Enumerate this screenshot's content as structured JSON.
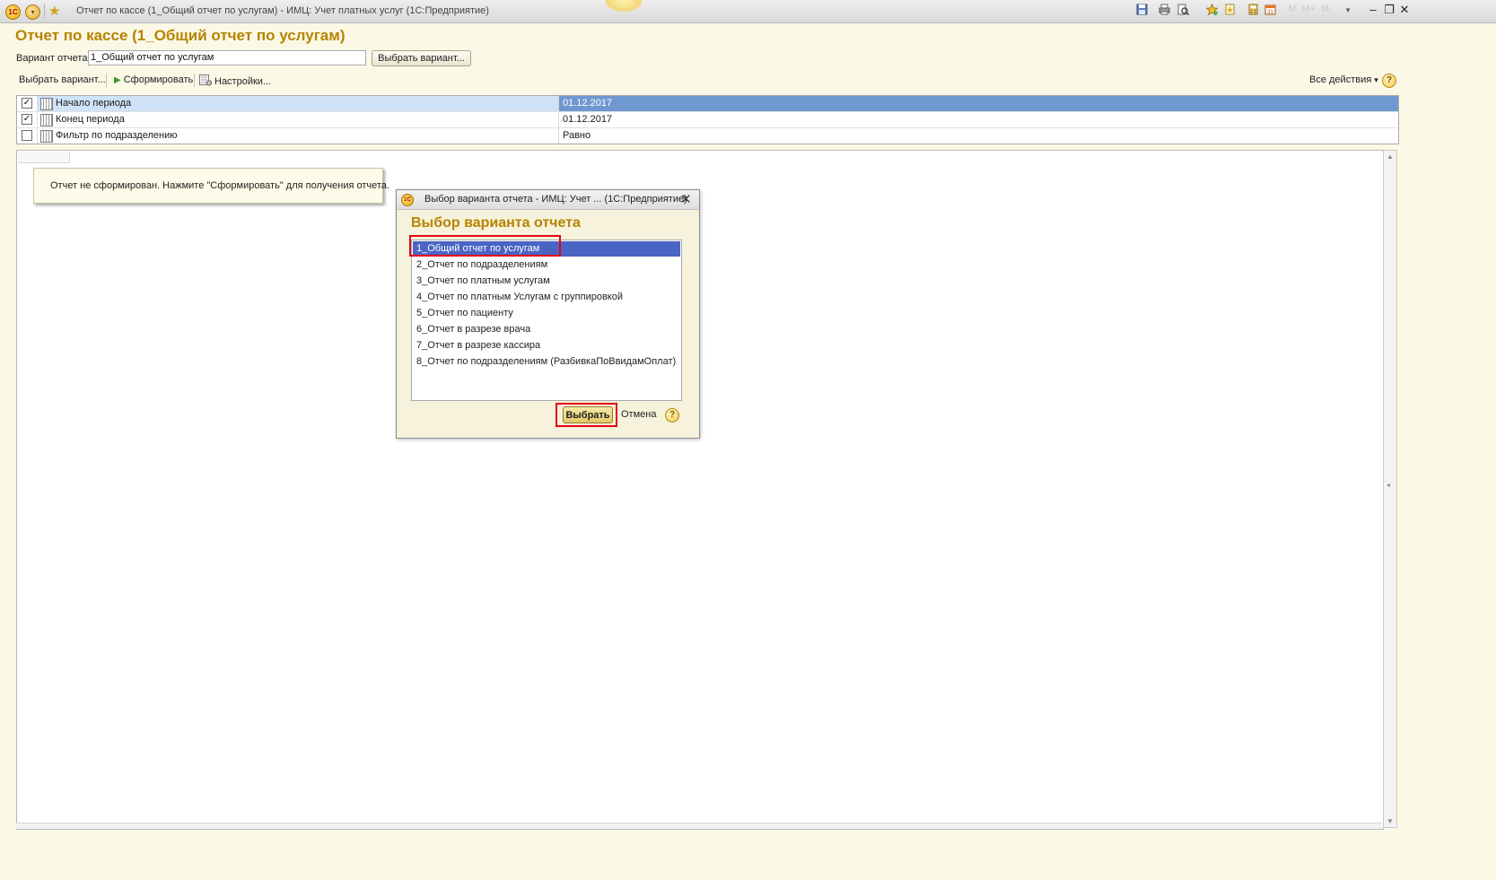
{
  "window": {
    "title": "Отчет по кассе (1_Общий отчет по услугам) - ИМЦ: Учет платных услуг  (1С:Предприятие)",
    "logo_text": "1С",
    "menu_glyph": "▾",
    "favorites_glyph": "★",
    "toolbar_icons": [
      "save-icon",
      "print-icon",
      "preview-icon",
      "favorites-add-icon",
      "history-icon",
      "calculator-icon",
      "calendar-icon",
      "memory-icon",
      "dropdown-icon"
    ],
    "controls": {
      "minimize": "‒",
      "restore": "❐",
      "close": "✕"
    }
  },
  "header": {
    "page_title": "Отчет по кассе (1_Общий отчет по услугам)",
    "variant_label": "Вариант отчета:",
    "variant_value": "1_Общий отчет по услугам",
    "choose_variant_button": "Выбрать вариант..."
  },
  "command_bar": {
    "choose_variant": "Выбрать вариант...",
    "generate": "Сформировать",
    "settings": "Настройки...",
    "all_actions": "Все действия",
    "all_actions_arrow": "▾",
    "help": "?"
  },
  "settings": {
    "rows": [
      {
        "checked": true,
        "check_glyph": "✓",
        "label": "Начало периода",
        "value": "01.12.2017",
        "extra": ""
      },
      {
        "checked": true,
        "check_glyph": "✓",
        "label": "Конец периода",
        "value": "01.12.2017",
        "extra": ""
      },
      {
        "checked": false,
        "check_glyph": "",
        "label": "Фильтр по подразделению",
        "value": "Равно",
        "extra": ""
      }
    ]
  },
  "report": {
    "notice": "Отчет не сформирован. Нажмите \"Сформировать\" для получения отчета."
  },
  "dialog": {
    "title": "Выбор варианта отчета - ИМЦ: Учет ...  (1С:Предприятие)",
    "heading": "Выбор варианта отчета",
    "items": [
      "1_Общий отчет по услугам",
      "2_Отчет по подразделениям",
      "3_Отчет по платным услугам",
      "4_Отчет по платным Услугам с группировкой",
      "5_Отчет по пациенту",
      "6_Отчет в разрезе врача",
      "7_Отчет в разрезе кассира",
      "8_Отчет по подразделениям (РазбивкаПоВвидамОплат)"
    ],
    "selected_index": 0,
    "choose_button": "Выбрать",
    "cancel_button": "Отмена",
    "help": "?",
    "close": "✕",
    "highlight_color": "#e30613"
  },
  "colors": {
    "title_gold": "#b78300",
    "selection_blue": "#4a64c4",
    "row_selected_value": "#6f98d0",
    "background": "#fbf8e6"
  }
}
